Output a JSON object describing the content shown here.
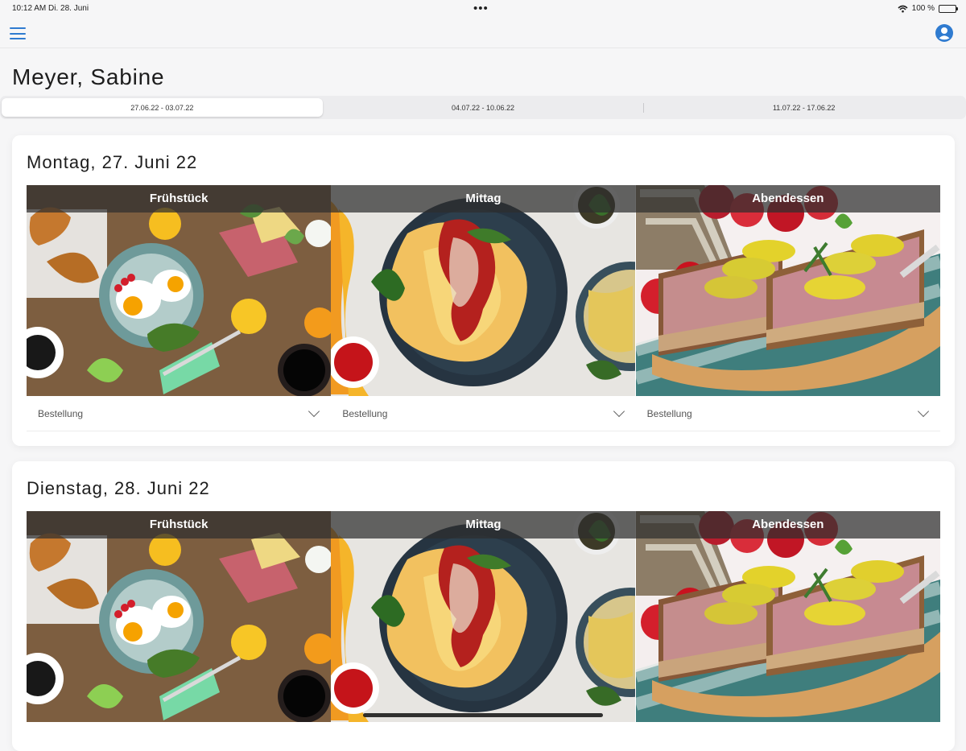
{
  "status_bar": {
    "time": "10:12 AM",
    "date": "Di. 28. Juni",
    "center_indicator": "•••",
    "battery_text": "100 %",
    "battery_level": 1.0,
    "icons": [
      "wifi-icon",
      "battery-icon"
    ]
  },
  "toolbar": {
    "menu_icon": "hamburger-menu-icon",
    "account_icon": "account-circle-icon",
    "accent_color": "#2f7bd0"
  },
  "page": {
    "title": "Meyer, Sabine"
  },
  "week_tabs": [
    {
      "label": "27.06.22 - 03.07.22",
      "selected": true
    },
    {
      "label": "04.07.22 - 10.06.22",
      "selected": false
    },
    {
      "label": "11.07.22 - 17.06.22",
      "selected": false
    }
  ],
  "days": [
    {
      "title": "Montag, 27. Juni 22",
      "meals": [
        {
          "name": "Frühstück",
          "dropdown_label": "Bestellung",
          "image": "breakfast-photo"
        },
        {
          "name": "Mittag",
          "dropdown_label": "Bestellung",
          "image": "pasta-photo"
        },
        {
          "name": "Abendessen",
          "dropdown_label": "Bestellung",
          "image": "bread-spread-photo"
        }
      ]
    },
    {
      "title": "Dienstag, 28. Juni 22",
      "meals": [
        {
          "name": "Frühstück",
          "image": "breakfast-photo"
        },
        {
          "name": "Mittag",
          "image": "pasta-photo"
        },
        {
          "name": "Abendessen",
          "image": "bread-spread-photo"
        }
      ]
    }
  ]
}
